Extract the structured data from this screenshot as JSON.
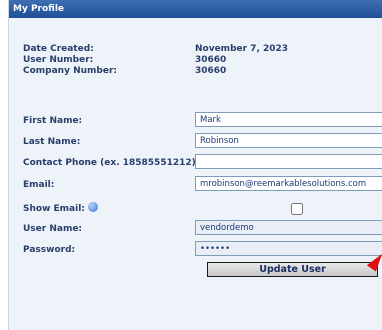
{
  "header": {
    "title": "My Profile"
  },
  "info": {
    "date_created_label": "Date Created:",
    "date_created_value": "November 7, 2023",
    "user_number_label": "User Number:",
    "user_number_value": "30660",
    "company_number_label": "Company Number:",
    "company_number_value": "30660"
  },
  "form": {
    "first_name_label": "First Name:",
    "first_name_value": "Mark",
    "last_name_label": "Last Name:",
    "last_name_value": "Robinson",
    "phone_label": "Contact Phone (ex. 18585551212):",
    "phone_value": "",
    "email_label": "Email:",
    "email_value": "mrobinson@reemarkablesolutions.com",
    "show_email_label": "Show Email:",
    "show_email_checked": false,
    "user_name_label": "User Name:",
    "user_name_value": "vendordemo",
    "password_label": "Password:",
    "password_value": "••••••"
  },
  "actions": {
    "update_label": "Update User"
  },
  "colors": {
    "header": "#1f4f95",
    "panel": "#eef3fa",
    "text": "#2a3e6b",
    "annotation_arrow": "#e01010"
  },
  "icons": {
    "show_email_help": "help-info-icon",
    "annotation": "red-arrow-icon"
  }
}
